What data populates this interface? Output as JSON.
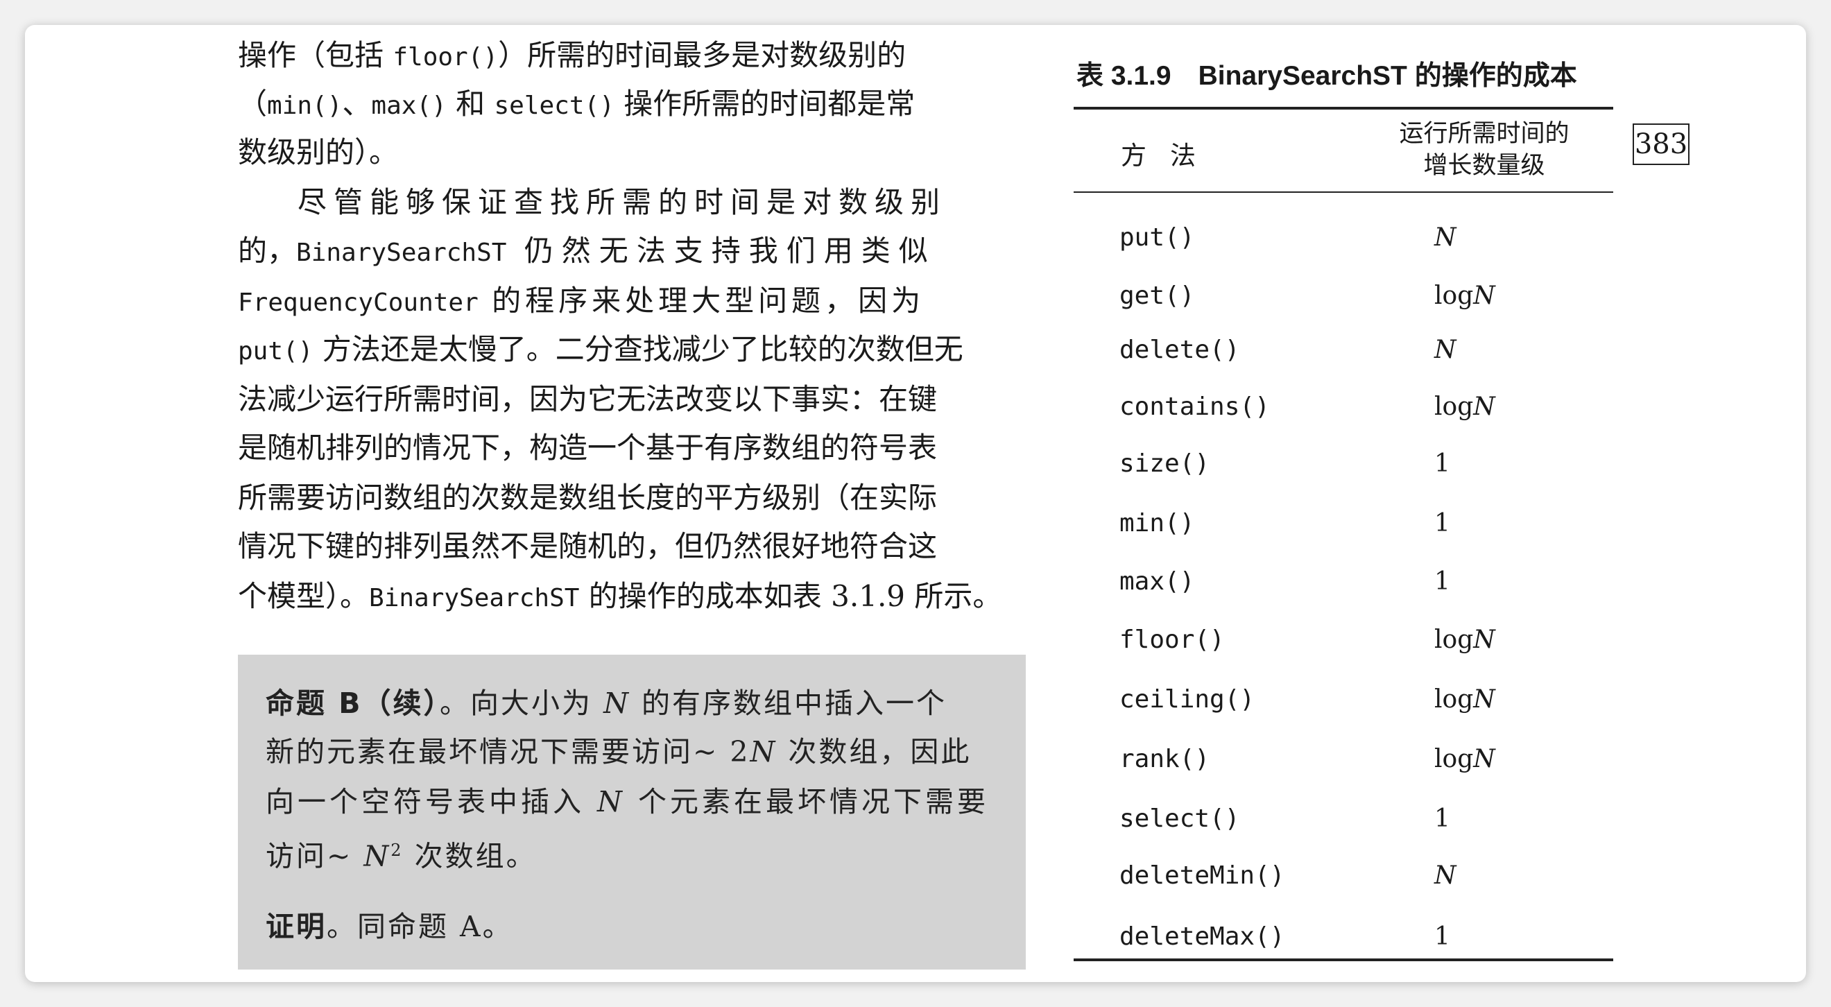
{
  "body_lines": [
    [
      "操作（包括 ",
      "floor()",
      "）所需的时间最多是对数级别的"
    ],
    [
      "（",
      "min()",
      "、",
      "max()",
      " 和 ",
      "select()",
      " 操作所需的时间都是常"
    ],
    [
      "数级别的）。"
    ],
    [
      "尽管能够保证查找所需的时间是对数级别"
    ],
    [
      "的，",
      "BinarySearchST",
      " 仍然无法支持我们用类似"
    ],
    [
      "FrequencyCounter",
      " 的程序来处理大型问题，因为"
    ],
    [
      "put()",
      " 方法还是太慢了。二分查找减少了比较的次数但无"
    ],
    [
      "法减少运行所需时间，因为它无法改变以下事实：在键"
    ],
    [
      "是随机排列的情况下，构造一个基于有序数组的符号表"
    ],
    [
      "所需要访问数组的次数是数组长度的平方级别（在实际"
    ],
    [
      "情况下键的排列虽然不是随机的，但仍然很好地符合这"
    ],
    [
      "个模型）。",
      "BinarySearchST",
      " 的操作的成本如表 3.1.9 所示。"
    ]
  ],
  "proposition": {
    "head": "命题 B（续）",
    "line1_rest": "。向大小为 ",
    "N": "N",
    "line1_end": " 的有序数组中插入一个",
    "line2_start": "新的元素在最坏情况下需要访问~ 2",
    "line2_end": " 次数组，因此",
    "line3_start": "向一个空符号表中插入 ",
    "line3_end": " 个元素在最坏情况下需要",
    "line4_start": "访问~ ",
    "sup2": "2",
    "line4_end": " 次数组。",
    "proof_head": "证明",
    "proof_rest": "。同命题 A。"
  },
  "table": {
    "title": "表 3.1.9　BinarySearchST 的操作的成本",
    "header_method": "方法",
    "header_growth_1": "运行所需时间的",
    "header_growth_2": "增长数量级",
    "rows": [
      {
        "method": "put()",
        "growth": "N"
      },
      {
        "method": "get()",
        "growth": "logN"
      },
      {
        "method": "delete()",
        "growth": "N"
      },
      {
        "method": "contains()",
        "growth": "logN"
      },
      {
        "method": "size()",
        "growth": "1"
      },
      {
        "method": "min()",
        "growth": "1"
      },
      {
        "method": "max()",
        "growth": "1"
      },
      {
        "method": "floor()",
        "growth": "logN"
      },
      {
        "method": "ceiling()",
        "growth": "logN"
      },
      {
        "method": "rank()",
        "growth": "logN"
      },
      {
        "method": "select()",
        "growth": "1"
      },
      {
        "method": "deleteMin()",
        "growth": "N"
      },
      {
        "method": "deleteMax()",
        "growth": "1"
      }
    ]
  },
  "page_number": "383"
}
